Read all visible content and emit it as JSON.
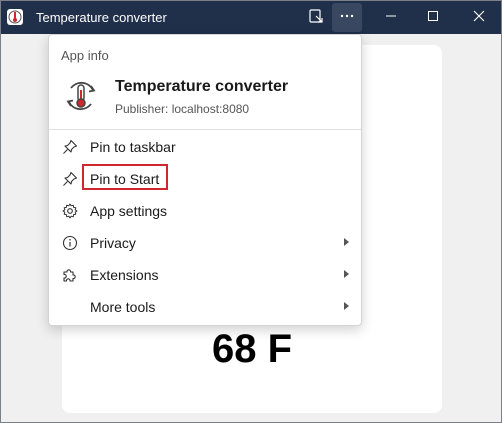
{
  "window": {
    "title": "Temperature converter",
    "app_icon": "thermometer-icon",
    "titlebar_color": "#202f4a"
  },
  "titlebar_buttons": {
    "open_in_browser": "open-in-browser-icon",
    "more": "more-icon",
    "minimize": "minimize-icon",
    "maximize": "maximize-icon",
    "close": "close-icon"
  },
  "content": {
    "temperature_value": "68 F"
  },
  "menu": {
    "section_label": "App info",
    "app_name": "Temperature converter",
    "publisher": "Publisher: localhost:8080",
    "items": [
      {
        "label": "Pin to taskbar",
        "icon": "pin-icon",
        "has_submenu": false
      },
      {
        "label": "Pin to Start",
        "icon": "pin-icon",
        "has_submenu": false,
        "highlighted": true
      },
      {
        "label": "App settings",
        "icon": "gear-icon",
        "has_submenu": false
      },
      {
        "label": "Privacy",
        "icon": "info-icon",
        "has_submenu": true
      },
      {
        "label": "Extensions",
        "icon": "puzzle-icon",
        "has_submenu": true
      },
      {
        "label": "More tools",
        "icon": "",
        "has_submenu": true
      }
    ],
    "highlight_color": "#d0262d"
  }
}
